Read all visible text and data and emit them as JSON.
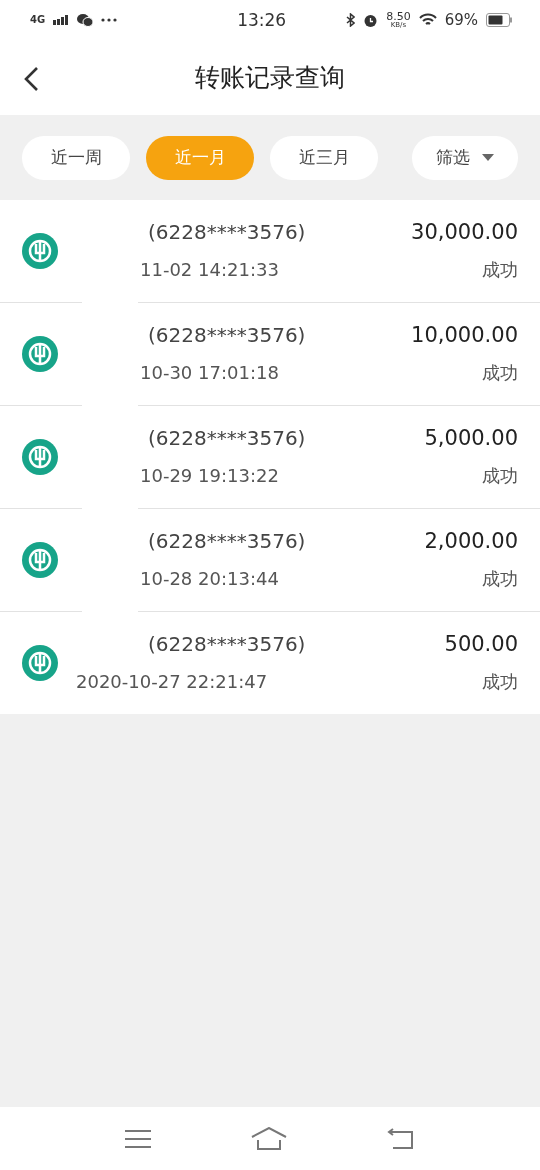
{
  "status_bar": {
    "network": "4G",
    "time": "13:26",
    "speed": "8.50",
    "speed_unit": "KB/s",
    "battery": "69%"
  },
  "header": {
    "title": "转账记录查询"
  },
  "filters": [
    {
      "label": "近一周",
      "selected": false
    },
    {
      "label": "近一月",
      "selected": true
    },
    {
      "label": "近三月",
      "selected": false
    }
  ],
  "filter_button": {
    "label": "筛选"
  },
  "records": [
    {
      "account": "(6228****3576)",
      "amount": "30,000.00",
      "date": "11-02 14:21:33",
      "status": "成功",
      "masked": true
    },
    {
      "account": "(6228****3576)",
      "amount": "10,000.00",
      "date": "10-30 17:01:18",
      "status": "成功",
      "masked": true
    },
    {
      "account": "(6228****3576)",
      "amount": "5,000.00",
      "date": "10-29 19:13:22",
      "status": "成功",
      "masked": true
    },
    {
      "account": "(6228****3576)",
      "amount": "2,000.00",
      "date": "10-28 20:13:44",
      "status": "成功",
      "masked": true
    },
    {
      "account": "(6228****3576)",
      "amount": "500.00",
      "date": "2020-10-27 22:21:47",
      "status": "成功",
      "masked": false
    }
  ]
}
